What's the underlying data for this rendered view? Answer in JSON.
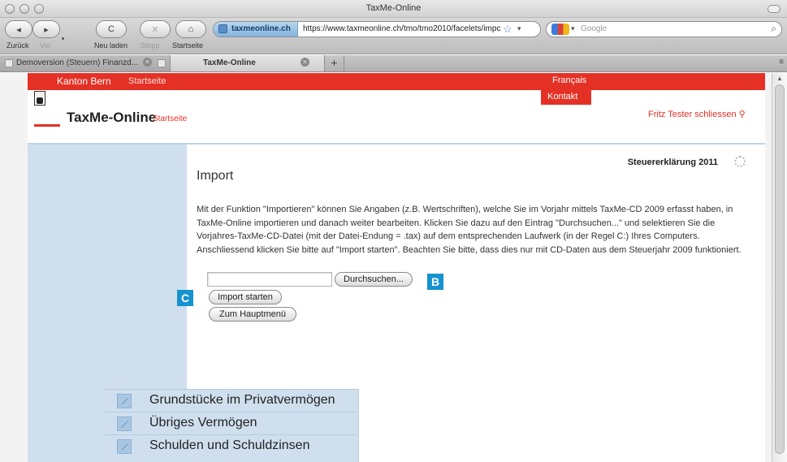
{
  "window": {
    "title": "TaxMe-Online"
  },
  "toolbar": {
    "back_label": "Zurück",
    "forward_label": "Vor",
    "reload_label": "Neu laden",
    "stop_label": "Stopp",
    "home_label": "Startseite",
    "back_icon": "◂",
    "forward_icon": "▸",
    "reload_icon": "C",
    "stop_icon": "✕",
    "home_icon": "⌂"
  },
  "urlbar": {
    "site": "taxmeonline.ch",
    "url": "https://www.taxmeonline.ch/tmo/tmo2010/facelets/impc",
    "star_icon": "☆",
    "dropdown_icon": "▾"
  },
  "search": {
    "placeholder": "Google",
    "icon": "⌕"
  },
  "tabs": [
    {
      "label": "Demoversion (Steuern) Finanzd...",
      "close_icon": "✕"
    },
    {
      "label": "TaxMe-Online",
      "close_icon": "✕"
    }
  ],
  "tab_new_label": "+",
  "tab_menu_icon": "≡",
  "header": {
    "kanton": "Kanton Bern",
    "kanton_start": "Startseite",
    "language": "Français",
    "kontakt": "Kontakt",
    "logo_text": "TaxMe-Online",
    "logo_start": "Startseite",
    "user_close": "Fritz Tester schliessen ⚲"
  },
  "main": {
    "tax_year_label": "Steuererklärung 2011",
    "title": "Import",
    "description": "Mit der Funktion \"Importieren\" können Sie Angaben (z.B. Wertschriften), welche Sie im Vorjahr mittels TaxMe-CD 2009 erfasst haben, in TaxMe-Online importieren und danach weiter bearbeiten. Klicken Sie dazu auf den Eintrag \"Durchsuchen...\" und selektieren Sie die Vorjahres-TaxMe-CD-Datei (mit der Datei-Endung = .tax) auf dem entsprechenden Laufwerk (in der Regel C:) Ihres Computers. Anschliessend klicken Sie bitte auf \"Import starten\". Beachten Sie bitte, dass dies nur mit CD-Daten aus dem Steuerjahr 2009 funktioniert.",
    "browse_button": "Durchsuchen...",
    "import_button": "Import starten",
    "menu_button": "Zum Hauptmenü"
  },
  "markers": {
    "b": "B",
    "c": "C"
  },
  "inset": {
    "items": [
      "Grundstücke im Privatvermögen",
      "Übriges Vermögen",
      "Schulden und Schuldzinsen"
    ]
  },
  "colors": {
    "brand_red": "#e53125",
    "sidebar_blue": "#cfdfee",
    "marker_blue": "#1592cf"
  }
}
